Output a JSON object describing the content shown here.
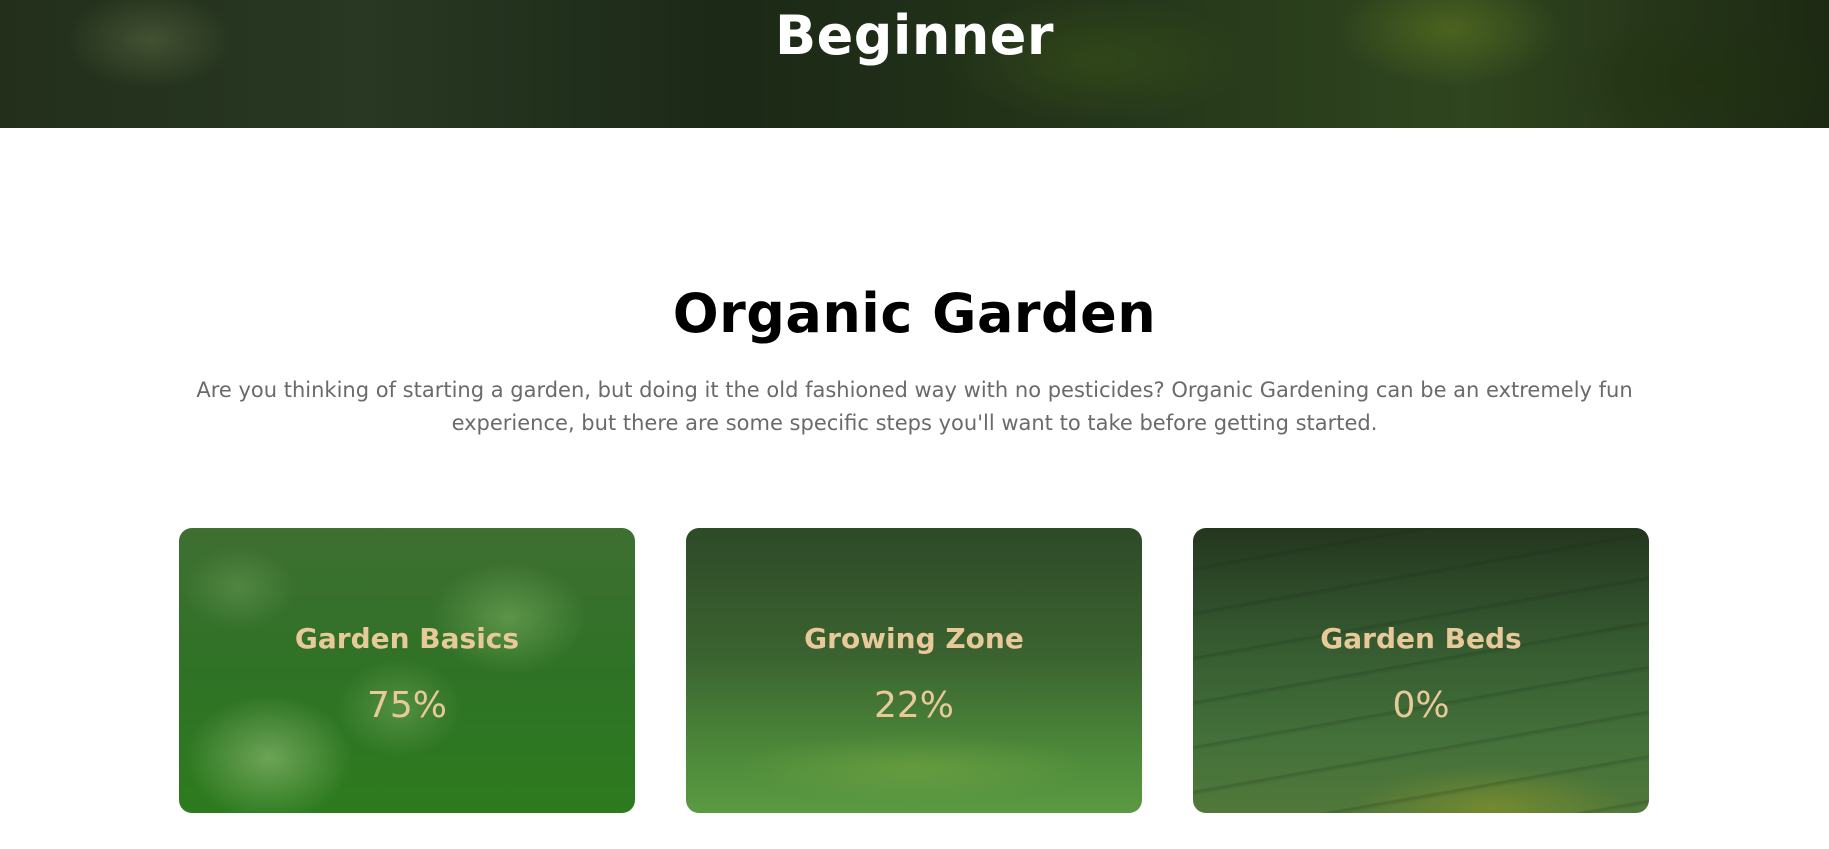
{
  "hero": {
    "title": "Beginner"
  },
  "section": {
    "title": "Organic Garden",
    "description": "Are you thinking of starting a garden, but doing it the old fashioned way with no pesticides? Organic Gardening can be an extremely fun experience, but there are some specific steps you'll want to take before getting started."
  },
  "cards": [
    {
      "title": "Garden Basics",
      "value": "75%"
    },
    {
      "title": "Growing Zone",
      "value": "22%"
    },
    {
      "title": "Garden Beds",
      "value": "0%"
    }
  ],
  "colors": {
    "card_text": "#e8c99a",
    "hero_text": "#ffffff",
    "description_text": "#6a6a6a"
  }
}
